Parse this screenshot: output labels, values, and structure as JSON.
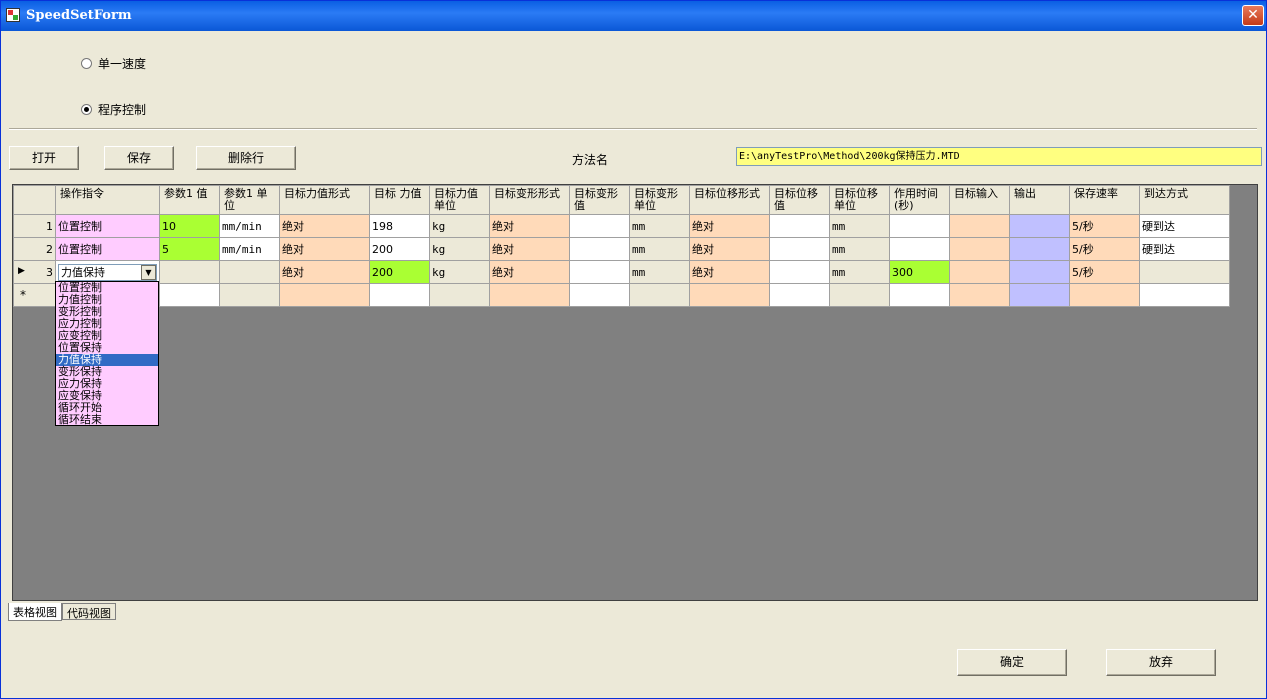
{
  "window": {
    "title": "SpeedSetForm",
    "close_glyph": "✕"
  },
  "mode": {
    "single_speed": "单一速度",
    "program_control": "程序控制",
    "selected": "program_control"
  },
  "toolbar": {
    "open": "打开",
    "save": "保存",
    "delete_row": "删除行"
  },
  "method": {
    "label": "方法名",
    "value": "E:\\anyTestPro\\Method\\200kg保持压力.MTD"
  },
  "grid": {
    "columns": [
      "操作指令",
      "参数1 值",
      "参数1 单位",
      "目标力值形式",
      "目标 力值",
      "目标力值单位",
      "目标变形形式",
      "目标变形值",
      "目标变形单位",
      "目标位移形式",
      "目标位移值",
      "目标位移单位",
      "作用时间(秒)",
      "目标输入",
      "输出",
      "保存速率",
      "到达方式"
    ],
    "rows": [
      {
        "num": "1",
        "cmd": "位置控制",
        "p1": "10",
        "p1u": "mm/min",
        "fform": "绝对",
        "fval": "198",
        "funit": "kg",
        "dform": "绝对",
        "dval": "",
        "dunit": "mm",
        "pform": "绝对",
        "pval": "",
        "punit": "mm",
        "time": "",
        "tin": "",
        "out": "",
        "rate": "5/秒",
        "arrive": "硬到达"
      },
      {
        "num": "2",
        "cmd": "位置控制",
        "p1": "5",
        "p1u": "mm/min",
        "fform": "绝对",
        "fval": "200",
        "funit": "kg",
        "dform": "绝对",
        "dval": "",
        "dunit": "mm",
        "pform": "绝对",
        "pval": "",
        "punit": "mm",
        "time": "",
        "tin": "",
        "out": "",
        "rate": "5/秒",
        "arrive": "硬到达"
      },
      {
        "num": "3",
        "cmd": "力值保持",
        "p1": "",
        "p1u": "",
        "fform": "绝对",
        "fval": "200",
        "funit": "kg",
        "dform": "绝对",
        "dval": "",
        "dunit": "mm",
        "pform": "绝对",
        "pval": "",
        "punit": "mm",
        "time": "300",
        "tin": "",
        "out": "",
        "rate": "5/秒",
        "arrive": ""
      }
    ],
    "new_row_marker": "*",
    "current_row_marker": "▶",
    "dropdown_options": [
      "位置控制",
      "力值控制",
      "变形控制",
      "应力控制",
      "应变控制",
      "位置保持",
      "力值保持",
      "变形保持",
      "应力保持",
      "应变保持",
      "循环开始",
      "循环结束"
    ],
    "dropdown_selected": "力值保持"
  },
  "tabs": {
    "table_view": "表格视图",
    "code_view": "代码视图"
  },
  "footer": {
    "ok": "确定",
    "cancel": "放弃"
  }
}
